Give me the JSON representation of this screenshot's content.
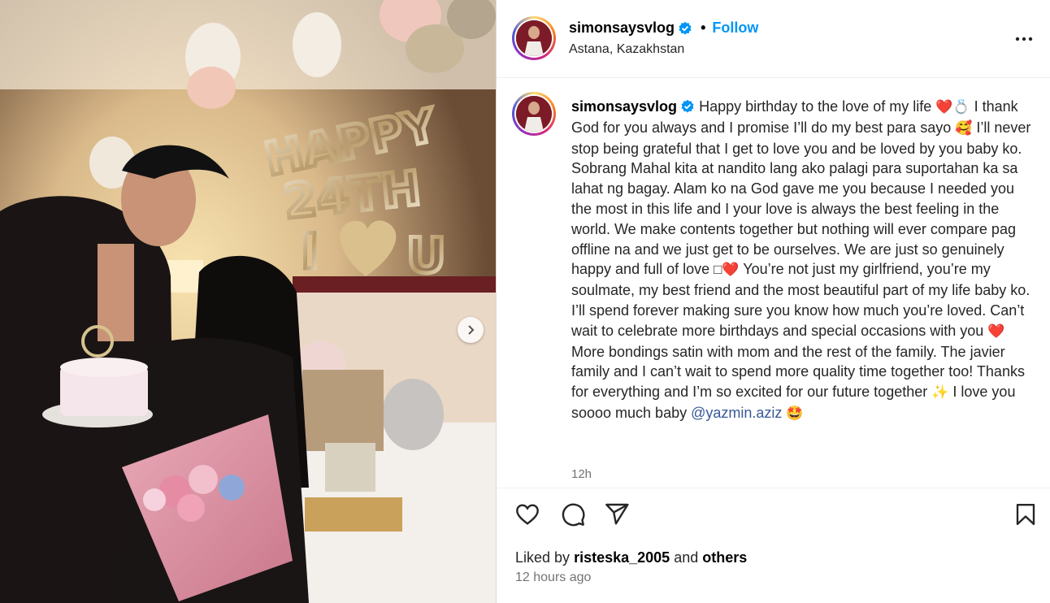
{
  "post": {
    "username": "simonsaysvlog",
    "follow_label": "Follow",
    "separator": "•",
    "location": "Astana, Kazakhstan",
    "more_icon": "more-horizontal-icon",
    "caption_parts": [
      "Happy birthday to the love of my life ",
      "❤️💍",
      " I thank God for you always and I promise I’ll do my best para sayo ",
      "🥰",
      " I’ll never stop being grateful that I get to love you and be loved by you baby ko. Sobrang Mahal kita at nandito lang ako palagi para suportahan ka sa lahat ng bagay. Alam ko na God gave me you because I needed you the most in this life and I your love is always the best feeling in the world. We make contents together but nothing will ever compare pag offline na and we just get to be ourselves. We are just so genuinely happy and full of love ",
      "□❤️",
      " You’re not just my girlfriend, you’re my soulmate, my best friend and the most beautiful part of my life baby ko. I’ll spend forever making sure you know how much you’re loved. Can’t wait to celebrate more birthdays and special occasions with you ",
      "❤️",
      " More bondings satin with mom and the rest of the family. The javier family and I can’t wait to spend more quality time together too! Thanks for everything and I’m so excited for our future together ",
      "✨",
      " I love you soooo much baby "
    ],
    "mention": "@yazmin.aziz",
    "end_emoji": "🤩",
    "caption_time": "12h",
    "liked_prefix": "Liked by",
    "liked_user": "risteska_2005",
    "liked_and": "and",
    "liked_others": "others",
    "posted_ago": "12 hours ago",
    "balloon_text": [
      "HAPPY",
      "24TH",
      "I",
      "U"
    ],
    "colors": {
      "accent": "#0095f6",
      "verified": "#0095f6",
      "mention": "#385898",
      "muted": "#737373"
    }
  }
}
